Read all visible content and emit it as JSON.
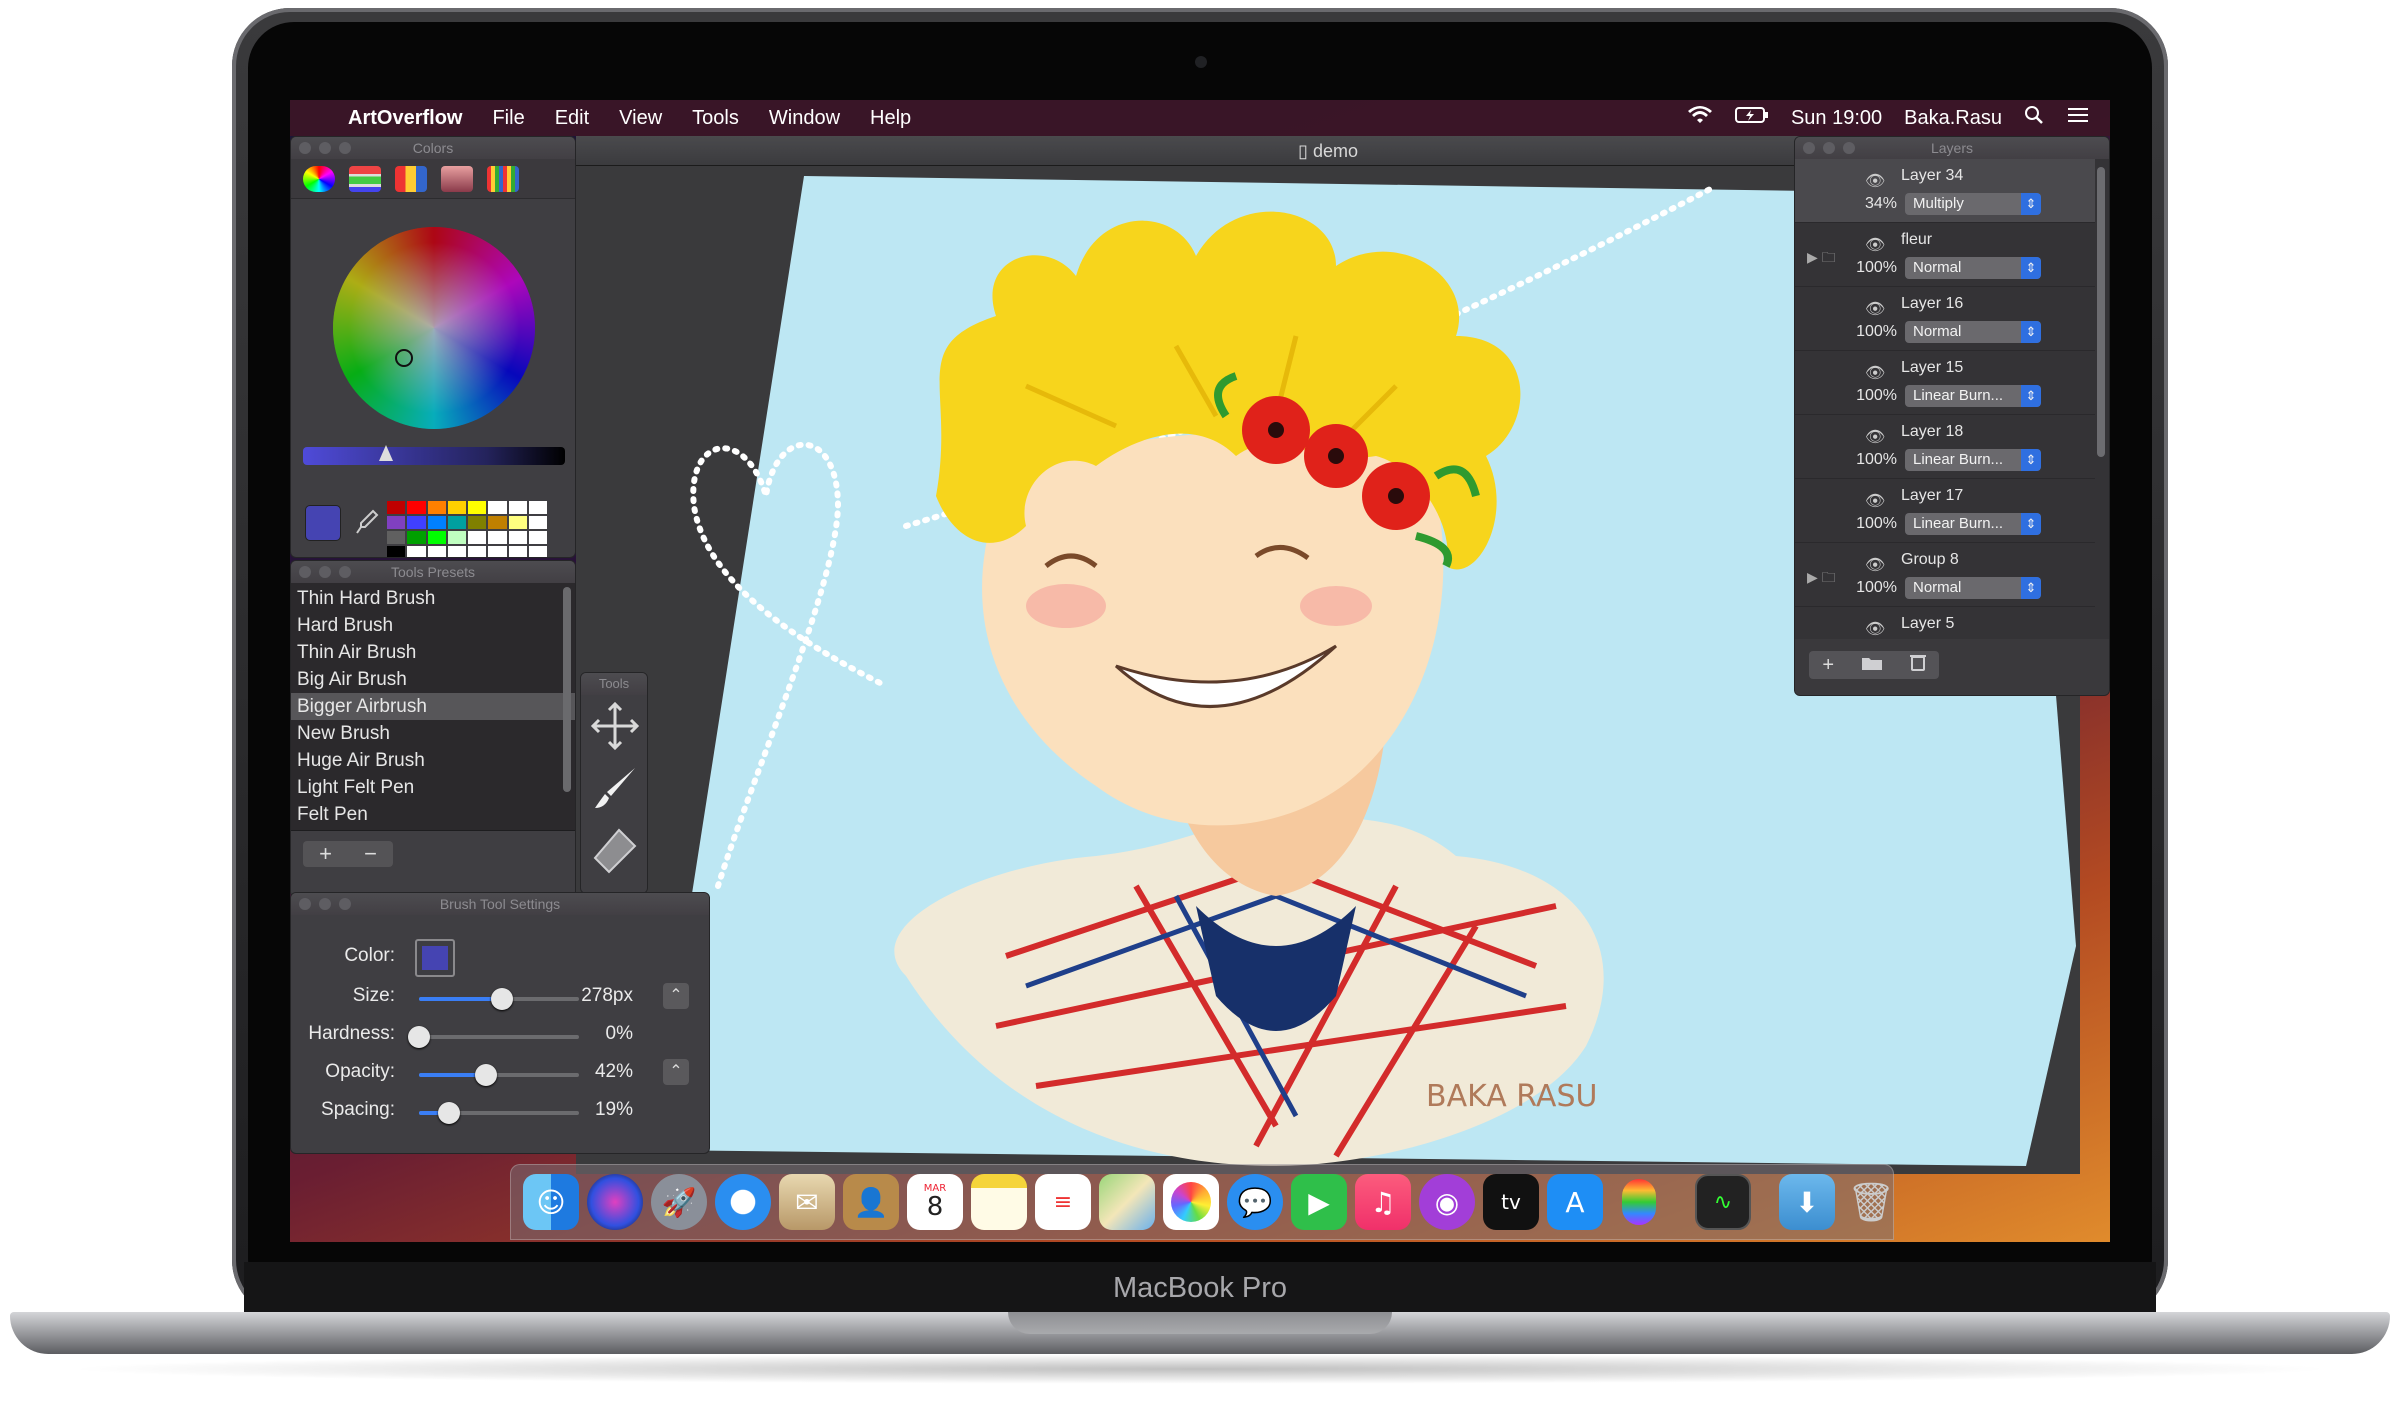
{
  "device": {
    "brand": "MacBook Pro"
  },
  "menubar": {
    "apple_icon": "apple-logo-icon",
    "app_name": "ArtOverflow",
    "menus": [
      "File",
      "Edit",
      "View",
      "Tools",
      "Window",
      "Help"
    ],
    "clock": "Sun 19:00",
    "user": "Baka.Rasu"
  },
  "document": {
    "title": "demo",
    "signature": "BAKA RASU"
  },
  "colors_panel": {
    "title": "Colors",
    "swatch_color": "#4544b2",
    "palette": [
      "#c00000",
      "#ff0000",
      "#ff8000",
      "#ffd000",
      "#ffff00",
      "#ffffff",
      "#ffffff",
      "#ffffff",
      "#8040c0",
      "#4040ff",
      "#0080ff",
      "#00a0a0",
      "#808000",
      "#c08000",
      "#ffff80",
      "#ffffff",
      "#606060",
      "#00a000",
      "#00ff00",
      "#c0ffc0",
      "#ffffff",
      "#ffffff",
      "#ffffff",
      "#ffffff",
      "#000000",
      "#ffffff",
      "#ffffff",
      "#ffffff",
      "#ffffff",
      "#ffffff",
      "#ffffff",
      "#ffffff"
    ]
  },
  "presets_panel": {
    "title": "Tools Presets",
    "items": [
      "Thin Hard Brush",
      "Hard Brush",
      "Thin Air Brush",
      "Big Air Brush",
      "Bigger Airbrush",
      "New Brush",
      "Huge Air Brush",
      "Light Felt Pen",
      "Felt Pen"
    ],
    "selected": "Bigger Airbrush",
    "add": "+",
    "remove": "−"
  },
  "tools_panel": {
    "title": "Tools"
  },
  "brush_settings": {
    "title": "Brush Tool Settings",
    "color_label": "Color:",
    "size_label": "Size:",
    "size_value": "278px",
    "size_fraction": 0.52,
    "hardness_label": "Hardness:",
    "hardness_value": "0%",
    "hardness_fraction": 0.0,
    "opacity_label": "Opacity:",
    "opacity_value": "42%",
    "opacity_fraction": 0.42,
    "spacing_label": "Spacing:",
    "spacing_value": "19%",
    "spacing_fraction": 0.19
  },
  "layers_panel": {
    "title": "Layers",
    "layers": [
      {
        "name": "Layer 34",
        "opacity": "34%",
        "blend": "Multiply",
        "folder": false
      },
      {
        "name": "fleur",
        "opacity": "100%",
        "blend": "Normal",
        "folder": true
      },
      {
        "name": "Layer 16",
        "opacity": "100%",
        "blend": "Normal",
        "folder": false
      },
      {
        "name": "Layer 15",
        "opacity": "100%",
        "blend": "Linear Burn...",
        "folder": false
      },
      {
        "name": "Layer 18",
        "opacity": "100%",
        "blend": "Linear Burn...",
        "folder": false
      },
      {
        "name": "Layer 17",
        "opacity": "100%",
        "blend": "Linear Burn...",
        "folder": false
      },
      {
        "name": "Group 8",
        "opacity": "100%",
        "blend": "Normal",
        "folder": true
      },
      {
        "name": "Layer 5",
        "opacity": "",
        "blend": "",
        "folder": false
      }
    ]
  },
  "dock": {
    "apps": [
      "Finder",
      "Siri",
      "Launchpad",
      "Safari",
      "Mail",
      "Contacts",
      "Calendar",
      "Notes",
      "Reminders",
      "Maps",
      "Photos",
      "Messages",
      "FaceTime",
      "Music",
      "Podcasts",
      "TV",
      "App Store",
      "ArtOverflow",
      "Activity Monitor",
      "Downloads",
      "Trash"
    ],
    "calendar_month": "MAR",
    "calendar_day": "8",
    "tv_label": "tv"
  }
}
